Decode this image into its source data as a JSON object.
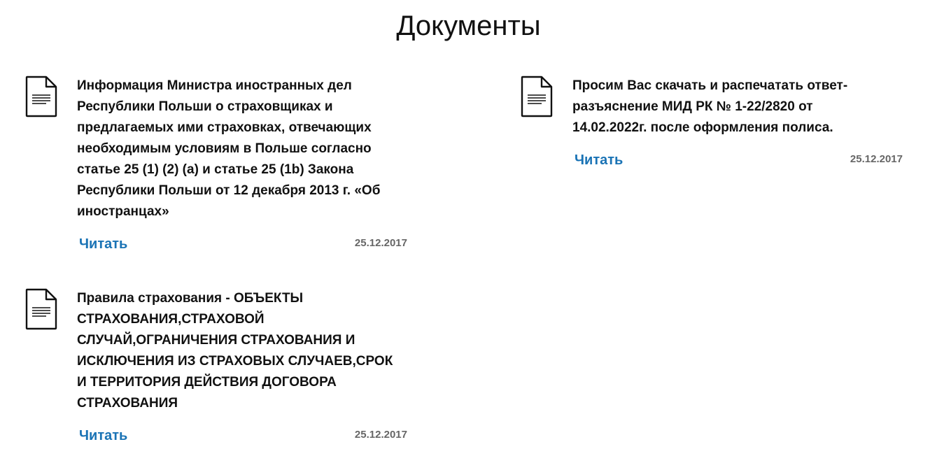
{
  "page": {
    "title": "Документы"
  },
  "documents": [
    {
      "title": "Информация Министра иностранных дел Республики Польши о страховщиках и предлагаемых ими страховках, отвечающих необходимым условиям в Польше согласно статье 25 (1) (2) (а) и статье 25 (1b) Закона Республики Польши от 12 декабря 2013 г. «Об иностранцах»",
      "read_label": "Читать",
      "date": "25.12.2017"
    },
    {
      "title": "Просим Вас скачать и распечатать ответ-разъяснение МИД РК № 1-22/2820 от 14.02.2022г. после оформления полиса.",
      "read_label": "Читать",
      "date": "25.12.2017"
    },
    {
      "title": "Правила страхования - ОБЪЕКТЫ СТРАХОВАНИЯ,СТРАХОВОЙ СЛУЧАЙ,ОГРАНИЧЕНИЯ СТРАХОВАНИЯ И ИСКЛЮЧЕНИЯ ИЗ СТРАХОВЫХ СЛУЧАЕВ,СРОК И ТЕРРИТОРИЯ ДЕЙСТВИЯ ДОГОВОРА СТРАХОВАНИЯ",
      "read_label": "Читать",
      "date": "25.12.2017"
    }
  ],
  "icons": {
    "document": "document-icon"
  },
  "colors": {
    "link": "#1a73b5",
    "date": "#666666",
    "text": "#111111"
  }
}
